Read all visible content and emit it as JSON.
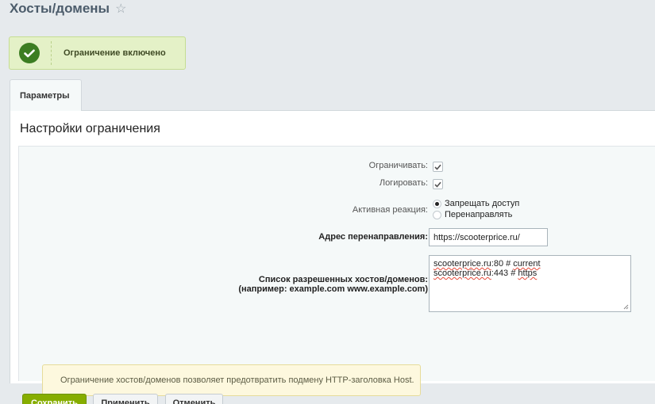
{
  "page": {
    "title": "Хосты/домены",
    "favorite_icon": "star-icon"
  },
  "notice": {
    "icon": "check-circle-icon",
    "text": "Ограничение включено",
    "color": "#3c7d22"
  },
  "tabs": [
    {
      "label": "Параметры",
      "active": true
    }
  ],
  "section": {
    "title": "Настройки ограничения"
  },
  "form": {
    "restrict": {
      "label": "Ограничивать:",
      "checked": true
    },
    "log": {
      "label": "Логировать:",
      "checked": true
    },
    "reaction": {
      "label": "Активная реакция:",
      "options": [
        {
          "label": "Запрещать доступ",
          "selected": true
        },
        {
          "label": "Перенаправлять",
          "selected": false
        }
      ]
    },
    "redirect": {
      "label": "Адрес перенаправления:",
      "value": "https://scooterprice.ru/"
    },
    "hosts": {
      "label_line1": "Список разрешенных хостов/доменов:",
      "label_line2": "(например: example.com www.example.com)",
      "lines": [
        {
          "host": "scooterprice.ru",
          "rest": ":80 # ",
          "comment": "current"
        },
        {
          "host": "scooterprice.ru",
          "rest": ":443 # ",
          "comment": "https"
        }
      ]
    },
    "hint": "Ограничение хостов/доменов позволяет предотвратить подмену HTTP-заголовка Host."
  },
  "buttons": {
    "save": "Сохранить",
    "apply": "Применить",
    "cancel": "Отменить"
  },
  "colors": {
    "accent_green": "#86ad00",
    "notice_bg": "#e4f1c7",
    "hint_bg": "#fdf8de"
  }
}
